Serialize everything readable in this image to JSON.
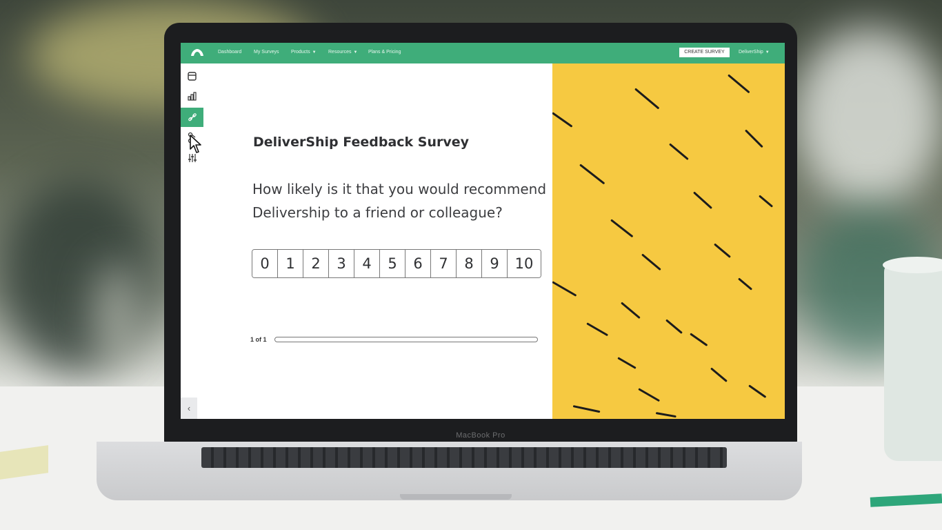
{
  "app": {
    "nav": {
      "items": [
        {
          "label": "Dashboard",
          "has_dropdown": false
        },
        {
          "label": "My Surveys",
          "has_dropdown": false
        },
        {
          "label": "Products",
          "has_dropdown": true
        },
        {
          "label": "Resources",
          "has_dropdown": true
        },
        {
          "label": "Plans & Pricing",
          "has_dropdown": false
        }
      ],
      "create_button": "CREATE SURVEY",
      "account_label": "DeliverShip",
      "brand_color": "#3fad7a"
    },
    "sidebar": {
      "icons": [
        {
          "name": "preview-icon",
          "active": false
        },
        {
          "name": "analyze-icon",
          "active": false
        },
        {
          "name": "collect-link-icon",
          "active": true
        },
        {
          "name": "logic-icon",
          "active": false
        },
        {
          "name": "options-sliders-icon",
          "active": false
        }
      ],
      "collapse_icon": "chevron-left-icon"
    },
    "survey": {
      "title": "DeliverShip Feedback Survey",
      "question": "How likely is it that you would recommend Delivership to a friend or colleague?",
      "scale": [
        "0",
        "1",
        "2",
        "3",
        "4",
        "5",
        "6",
        "7",
        "8",
        "9",
        "10"
      ],
      "progress_label": "1 of 1",
      "progress_fraction": 0
    },
    "panel_color": "#f6c941"
  },
  "device": {
    "model_label": "MacBook Pro"
  }
}
